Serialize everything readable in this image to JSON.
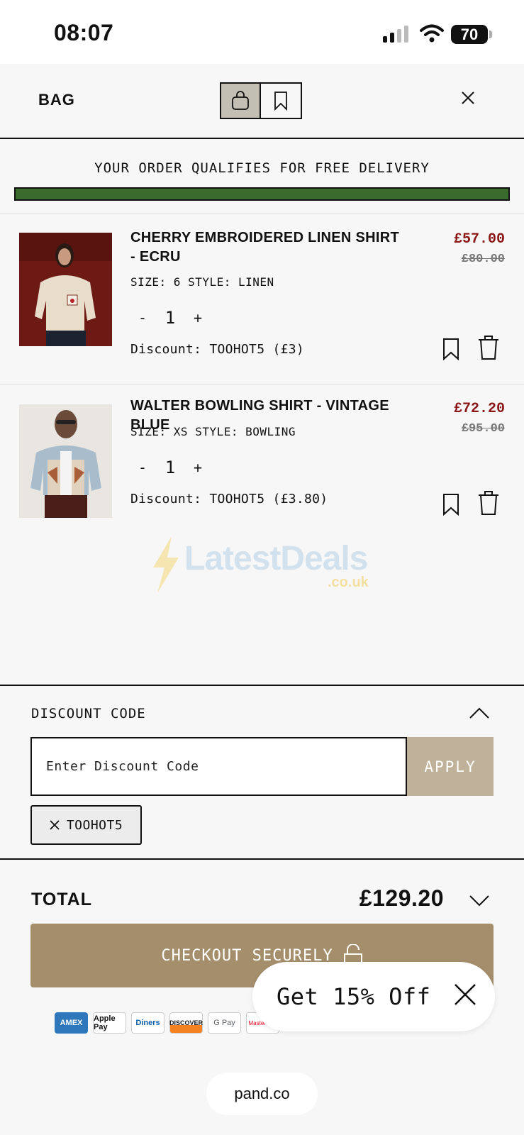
{
  "status_bar": {
    "time": "08:07",
    "battery": "70"
  },
  "header": {
    "title": "BAG",
    "bag_tab_icon": "shopping-bag-icon",
    "saved_tab_icon": "bookmark-icon",
    "close_icon": "close-icon"
  },
  "banner": {
    "message": "YOUR ORDER QUALIFIES FOR FREE DELIVERY",
    "progress_percent": 100,
    "progress_color": "#3b6a2d"
  },
  "items": [
    {
      "name": "CHERRY EMBROIDERED LINEN SHIRT - ECRU",
      "meta": "SIZE: 6  STYLE: LINEN",
      "qty_minus": "-",
      "qty": "1",
      "qty_plus": "+",
      "discount": "Discount: TOOHOT5 (£3)",
      "price": "£57.00",
      "old_price": "£80.00"
    },
    {
      "name": "WALTER BOWLING SHIRT - VINTAGE BLUE",
      "meta": "SIZE: XS  STYLE: BOWLING",
      "qty_minus": "-",
      "qty": "1",
      "qty_plus": "+",
      "discount": "Discount: TOOHOT5 (£3.80)",
      "price": "£72.20",
      "old_price": "£95.00"
    }
  ],
  "watermark": {
    "text": "LatestDeals",
    "sub": ".co.uk"
  },
  "discount_section": {
    "label": "DISCOUNT CODE",
    "placeholder": "Enter Discount Code",
    "apply_label": "APPLY",
    "applied_code": "TOOHOT5"
  },
  "total": {
    "label": "TOTAL",
    "value": "£129.20"
  },
  "checkout": {
    "label": "CHECKOUT SECURELY"
  },
  "payments": [
    "AMEX",
    "Apple Pay",
    "Diners",
    "DISCOVER",
    "G Pay",
    "Mastercard"
  ],
  "promo": {
    "text": "Get 15% Off"
  },
  "browser": {
    "url": "pand.co"
  },
  "colors": {
    "price_red": "#8b1616",
    "checkout_bg": "#a48e6c",
    "apply_bg": "#c0b29a"
  }
}
